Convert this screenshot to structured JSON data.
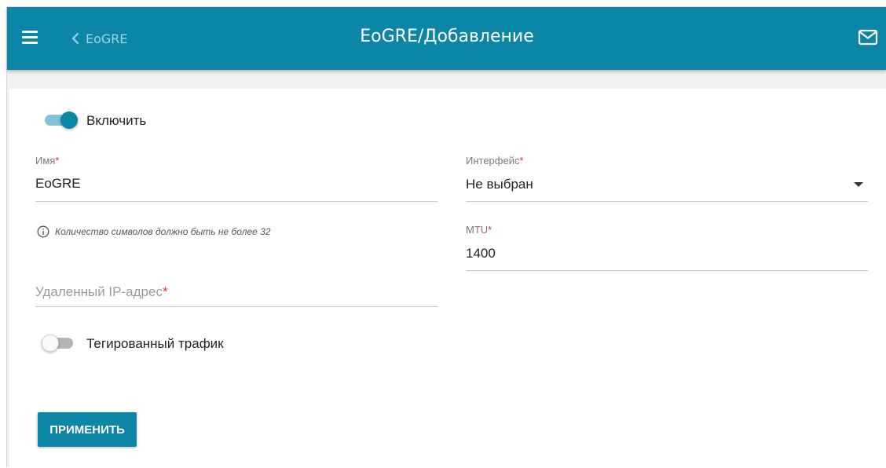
{
  "header": {
    "title": "EoGRE/Добавление",
    "back_label": "EoGRE",
    "menu_icon": "hamburger-menu-icon",
    "back_icon": "chevron-left-icon",
    "mail_icon": "envelope-icon"
  },
  "form": {
    "enable": {
      "label": "Включить",
      "checked": true
    },
    "name": {
      "label": "Имя",
      "required_mark": "*",
      "value": "EoGRE"
    },
    "name_hint": "Количество символов должно быть не более 32",
    "hint_icon": "info-icon",
    "remote_ip": {
      "placeholder": "Удаленный IP-адрес",
      "required_mark": "*",
      "value": ""
    },
    "tagged_traffic": {
      "label": "Тегированный трафик",
      "checked": false
    },
    "interface": {
      "label": "Интерфейс",
      "required_mark": "*",
      "value": "Не выбран"
    },
    "mtu": {
      "label": "MTU",
      "required_mark": "*",
      "value": "1400"
    },
    "apply_label": "ПРИМЕНИТЬ"
  },
  "colors": {
    "accent": "#0c86a6",
    "toggle_track_on": "#7fc4d7",
    "required": "#d8352a",
    "background": "#f1f1f1"
  }
}
